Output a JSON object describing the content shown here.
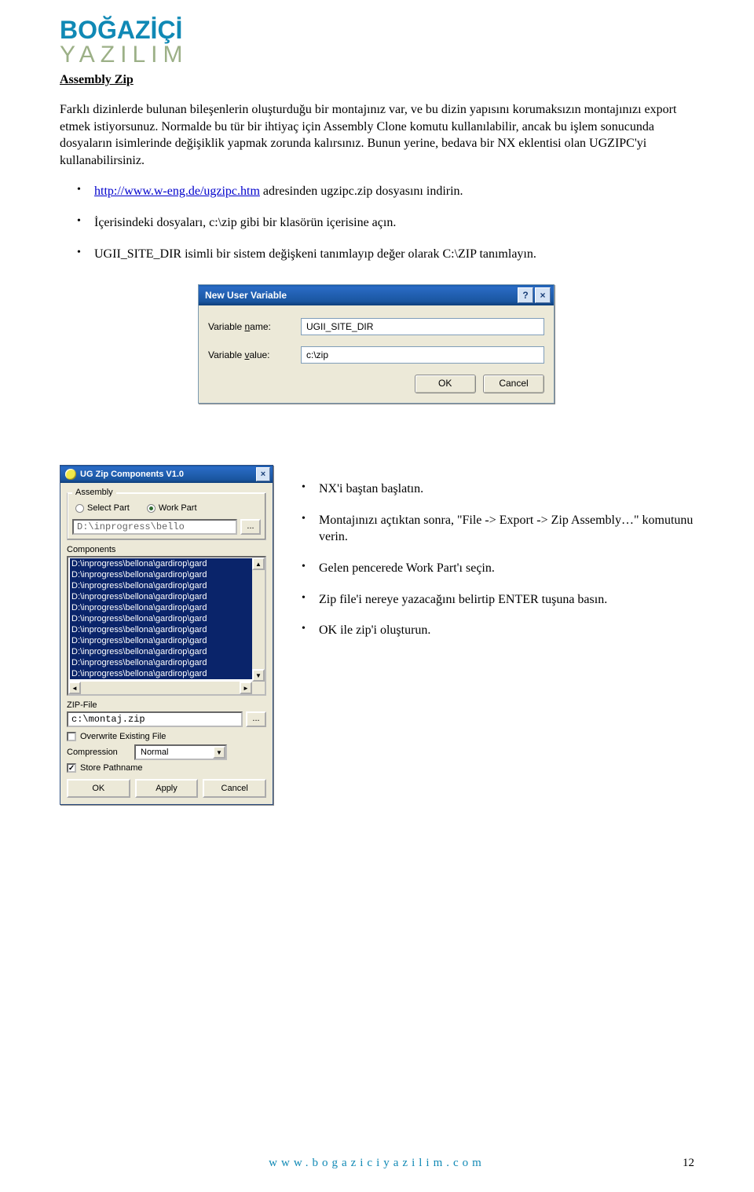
{
  "logo": {
    "line1": "BOĞAZİÇİ",
    "line2": "YAZILIM"
  },
  "heading": "Assembly Zip",
  "para1": "Farklı dizinlerde bulunan bileşenlerin oluşturduğu bir montajınız var, ve bu dizin yapısını korumaksızın montajınızı export etmek istiyorsunuz. Normalde bu tür bir ihtiyaç için Assembly Clone komutu kullanılabilir, ancak bu işlem sonucunda dosyaların isimlerinde değişiklik yapmak zorunda kalırsınız. Bunun yerine, bedava bir NX eklentisi olan UGZIPC'yi kullanabilirsiniz.",
  "bullets1": {
    "b1_link": "http://www.w-eng.de/ugzipc.htm",
    "b1_rest": " adresinden ugzipc.zip dosyasını indirin.",
    "b2": "İçerisindeki dosyaları, c:\\zip gibi bir klasörün içerisine açın.",
    "b3": "UGII_SITE_DIR isimli bir sistem değişkeni tanımlayıp değer olarak C:\\ZIP tanımlayın."
  },
  "dialog1": {
    "title": "New User Variable",
    "help": "?",
    "close": "×",
    "label_name_pre": "Variable ",
    "label_name_ul": "n",
    "label_name_post": "ame:",
    "value_name": "UGII_SITE_DIR",
    "label_value_pre": "Variable ",
    "label_value_ul": "v",
    "label_value_post": "alue:",
    "value_value": "c:\\zip",
    "ok": "OK",
    "cancel": "Cancel"
  },
  "dialog2": {
    "title": "UG Zip Components V1.0",
    "close": "×",
    "assembly_legend": "Assembly",
    "radio1": "Select Part",
    "radio2": "Work Part",
    "assembly_path": "D:\\inprogress\\bello",
    "browse": "...",
    "components_label": "Components",
    "components": [
      "D:\\inprogress\\bellona\\gardirop\\gard",
      "D:\\inprogress\\bellona\\gardirop\\gard",
      "D:\\inprogress\\bellona\\gardirop\\gard",
      "D:\\inprogress\\bellona\\gardirop\\gard",
      "D:\\inprogress\\bellona\\gardirop\\gard",
      "D:\\inprogress\\bellona\\gardirop\\gard",
      "D:\\inprogress\\bellona\\gardirop\\gard",
      "D:\\inprogress\\bellona\\gardirop\\gard",
      "D:\\inprogress\\bellona\\gardirop\\gard",
      "D:\\inprogress\\bellona\\gardirop\\gard",
      "D:\\inprogress\\bellona\\gardirop\\gard"
    ],
    "zipfile_label": "ZIP-File",
    "zipfile_value": "c:\\montaj.zip",
    "overwrite": "Overwrite Existing File",
    "compression_label": "Compression",
    "compression_value": "Normal",
    "store": "Store Pathname",
    "ok": "OK",
    "apply": "Apply",
    "cancel": "Cancel"
  },
  "bullets2": {
    "b1": "NX'i baştan başlatın.",
    "b2": "Montajınızı açtıktan sonra, \"File -> Export -> Zip Assembly…\" komutunu verin.",
    "b3": "Gelen pencerede Work Part'ı seçin.",
    "b4": "Zip file'i nereye yazacağını belirtip ENTER tuşuna basın.",
    "b5": "OK ile zip'i oluşturun."
  },
  "footer": {
    "url": "www.bogaziciyazilim.com",
    "page": "12"
  }
}
